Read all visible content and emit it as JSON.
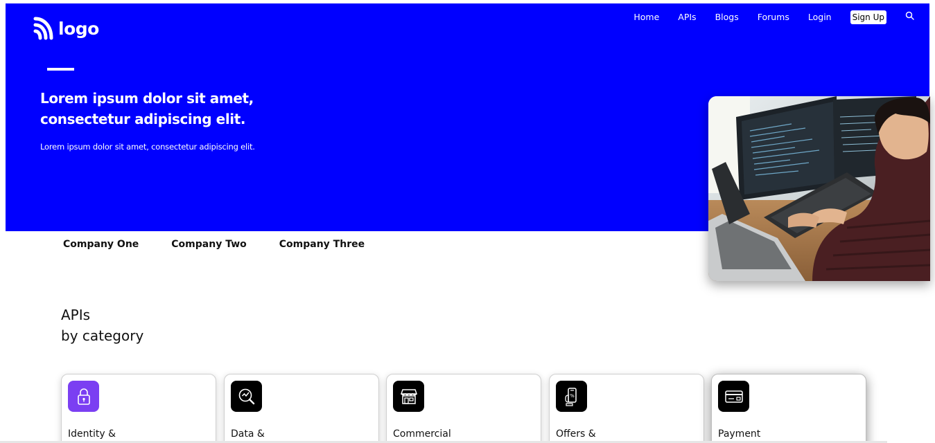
{
  "logo": {
    "text": "logo"
  },
  "nav": {
    "items": [
      "Home",
      "APIs",
      "Blogs",
      "Forums",
      "Login"
    ],
    "signup_label": "Sign Up"
  },
  "hero": {
    "title": "Lorem ipsum dolor sit amet, consectetur adipiscing elit.",
    "subtitle": "Lorem ipsum dolor sit amet, consectetur adipiscing elit.",
    "background_color": "#0000ff",
    "image": "developer-at-computer-photo"
  },
  "companies": [
    "Company One",
    "Company Two",
    "Company Three"
  ],
  "apis_section": {
    "title_line1": "APIs",
    "title_line2": "by category"
  },
  "categories": [
    {
      "label": "Identity &",
      "icon": "lock-icon",
      "icon_bg": "#7b3ff2"
    },
    {
      "label": "Data &",
      "icon": "analytics-search-icon",
      "icon_bg": "#000000"
    },
    {
      "label": "Commercial",
      "icon": "storefront-icon",
      "icon_bg": "#000000"
    },
    {
      "label": "Offers &",
      "icon": "mobile-offer-icon",
      "icon_bg": "#000000"
    },
    {
      "label": "Payment",
      "icon": "credit-card-icon",
      "icon_bg": "#000000"
    }
  ]
}
